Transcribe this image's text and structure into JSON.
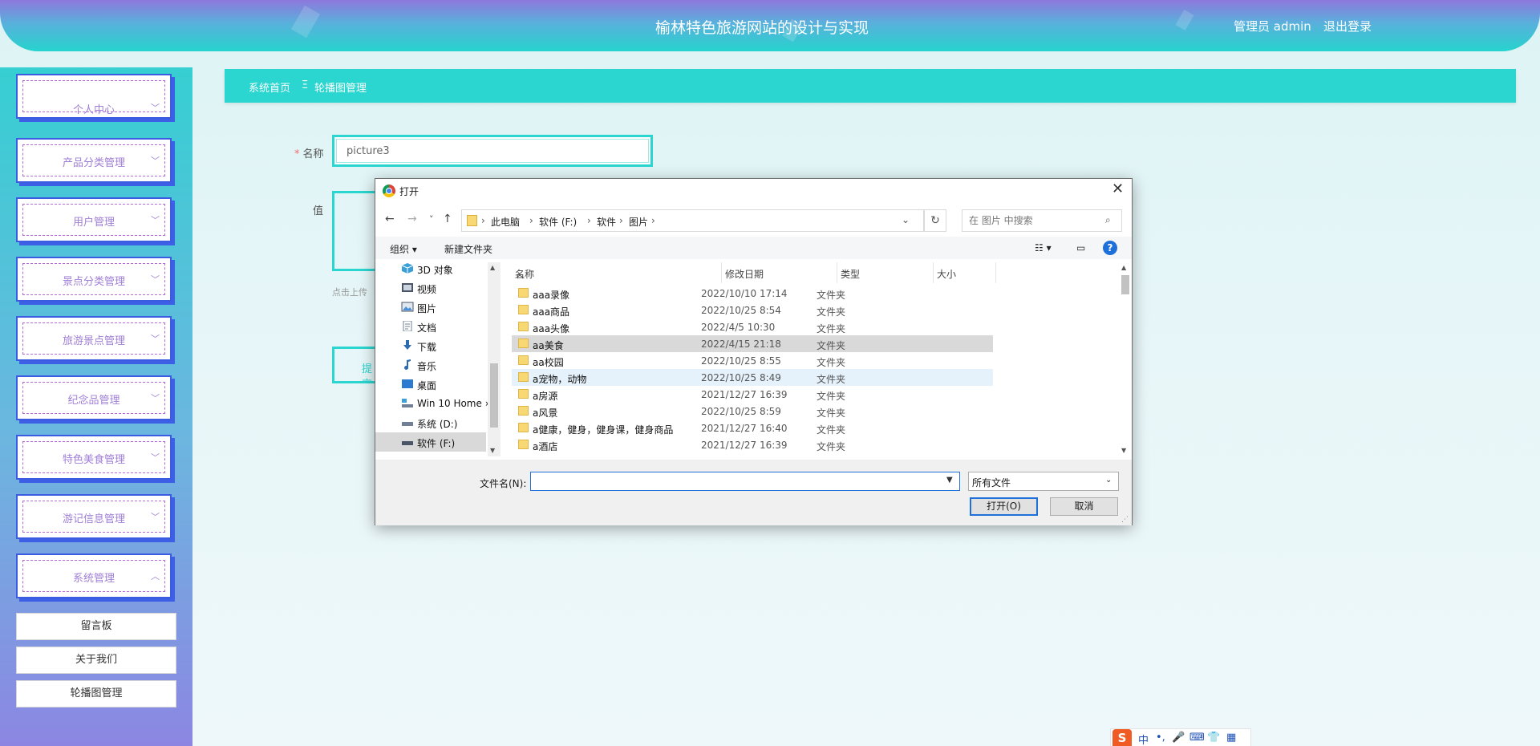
{
  "header": {
    "title": "榆林特色旅游网站的设计与实现",
    "user_label": "管理员 admin",
    "logout_label": "退出登录"
  },
  "sidebar": {
    "menus": [
      {
        "label": "个人中心",
        "chevron": "chevron-down-icon",
        "glyph": "﹀"
      },
      {
        "label": "产品分类管理",
        "chevron": "chevron-down-icon",
        "glyph": "﹀"
      },
      {
        "label": "用户管理",
        "chevron": "chevron-down-icon",
        "glyph": "﹀"
      },
      {
        "label": "景点分类管理",
        "chevron": "chevron-down-icon",
        "glyph": "﹀"
      },
      {
        "label": "旅游景点管理",
        "chevron": "chevron-down-icon",
        "glyph": "﹀"
      },
      {
        "label": "纪念品管理",
        "chevron": "chevron-down-icon",
        "glyph": "﹀"
      },
      {
        "label": "特色美食管理",
        "chevron": "chevron-down-icon",
        "glyph": "﹀"
      },
      {
        "label": "游记信息管理",
        "chevron": "chevron-down-icon",
        "glyph": "﹀"
      },
      {
        "label": "系统管理",
        "chevron": "chevron-up-icon",
        "glyph": "︿"
      }
    ],
    "sub_items": [
      "留言板",
      "关于我们",
      "轮播图管理"
    ]
  },
  "breadcrumb": {
    "home": "系统首页",
    "separator": "Ξ",
    "current": "轮播图管理"
  },
  "form": {
    "name_label": "名称",
    "name_required": "*",
    "name_value": "picture3",
    "value_label": "值",
    "upload_tip": "点击上传",
    "submit_label": "提交"
  },
  "dialog": {
    "title": "打开",
    "close": "✕",
    "nav": {
      "back": "←",
      "forward": "→",
      "recent": "˅",
      "up": "↑"
    },
    "path": [
      "此电脑",
      "软件 (F:)",
      "软件",
      "图片"
    ],
    "path_sep": "›",
    "refresh": "↻",
    "search_placeholder": "在 图片 中搜索",
    "organize_label": "组织 ▾",
    "new_folder_label": "新建文件夹",
    "view_label": "☷ ▾",
    "help_label": "?",
    "nav_items": [
      {
        "label": "3D 对象",
        "icon": "3d-objects-icon"
      },
      {
        "label": "视频",
        "icon": "video-icon"
      },
      {
        "label": "图片",
        "icon": "pictures-icon"
      },
      {
        "label": "文档",
        "icon": "documents-icon"
      },
      {
        "label": "下载",
        "icon": "download-icon"
      },
      {
        "label": "音乐",
        "icon": "music-icon"
      },
      {
        "label": "桌面",
        "icon": "desktop-icon"
      },
      {
        "label": "Win 10 Home ›",
        "icon": "drive-icon"
      },
      {
        "label": "系统 (D:)",
        "icon": "drive-icon"
      },
      {
        "label": "软件 (F:)",
        "icon": "drive-icon",
        "selected": true
      }
    ],
    "columns": [
      "名称",
      "修改日期",
      "类型",
      "大小"
    ],
    "rows": [
      {
        "name": "aaa录像",
        "date": "2022/10/10 17:14",
        "type": "文件夹"
      },
      {
        "name": "aaa商品",
        "date": "2022/10/25 8:54",
        "type": "文件夹"
      },
      {
        "name": "aaa头像",
        "date": "2022/4/5 10:30",
        "type": "文件夹"
      },
      {
        "name": "aa美食",
        "date": "2022/4/15 21:18",
        "type": "文件夹",
        "selected": true
      },
      {
        "name": "aa校园",
        "date": "2022/10/25 8:55",
        "type": "文件夹"
      },
      {
        "name": "a宠物，动物",
        "date": "2022/10/25 8:49",
        "type": "文件夹",
        "hover": true
      },
      {
        "name": "a房源",
        "date": "2021/12/27 16:39",
        "type": "文件夹"
      },
      {
        "name": "a风景",
        "date": "2022/10/25 8:59",
        "type": "文件夹"
      },
      {
        "name": "a健康，健身，健身课，健身商品",
        "date": "2021/12/27 16:40",
        "type": "文件夹"
      },
      {
        "name": "a酒店",
        "date": "2021/12/27 16:39",
        "type": "文件夹"
      }
    ],
    "filename_label": "文件名(N):",
    "filename_value": "",
    "filetype_value": "所有文件",
    "open_label": "打开(O)",
    "cancel_label": "取消"
  },
  "ime": {
    "logo": "S",
    "glyphs": [
      "中",
      "•,",
      "🎤",
      "⌨",
      "👕",
      "▦"
    ]
  },
  "colors": {
    "accent": "#2ad6cf",
    "menu_border": "#3b5be0",
    "menu_text": "#a07fd6",
    "required": "#f56c6c",
    "dialog_primary": "#1e6fd9"
  }
}
